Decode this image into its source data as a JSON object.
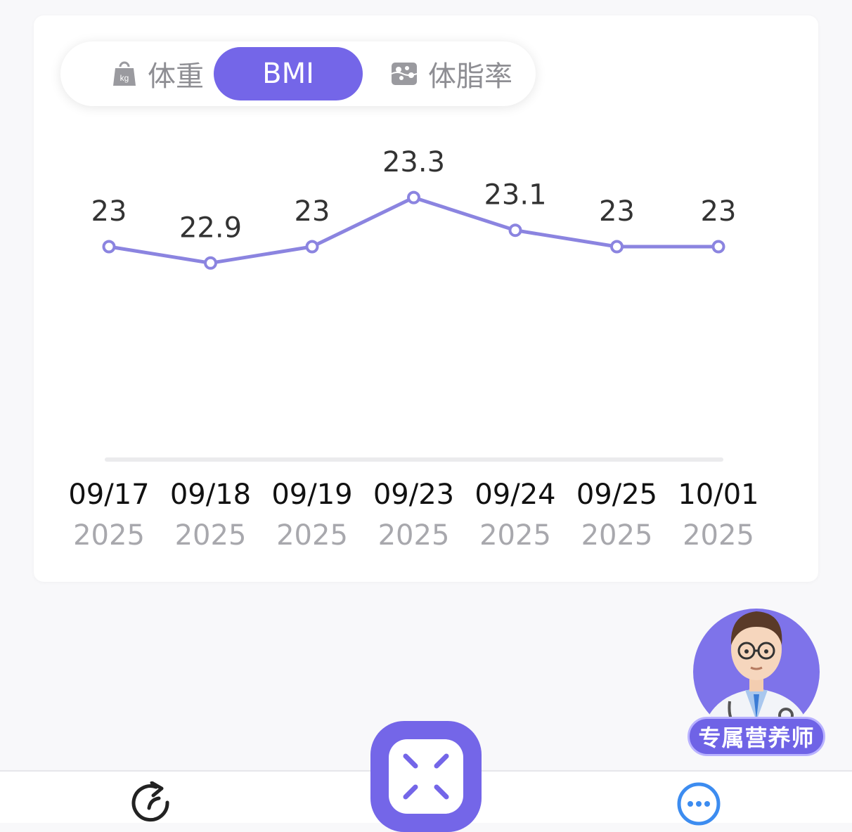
{
  "tabs": [
    {
      "label": "体重",
      "icon": "weight-bag-icon",
      "active": false
    },
    {
      "label": "BMI",
      "icon": "",
      "active": true
    },
    {
      "label": "体脂率",
      "icon": "body-fat-icon",
      "active": false
    }
  ],
  "colors": {
    "accent": "#7466e8",
    "line": "#8b84e0",
    "date_text": "#111111",
    "year_text": "#a8a8ad",
    "label_text": "#333333"
  },
  "chart_data": {
    "type": "line",
    "x": [
      "09/17",
      "09/18",
      "09/19",
      "09/23",
      "09/24",
      "09/25",
      "10/01"
    ],
    "x_sublabels": [
      "2025",
      "2025",
      "2025",
      "2025",
      "2025",
      "2025",
      "2025"
    ],
    "series": [
      {
        "values": [
          23,
          22.9,
          23,
          23.3,
          23.1,
          23,
          23
        ]
      }
    ],
    "data_labels": [
      "23",
      "22.9",
      "23",
      "23.3",
      "23.1",
      "23",
      "23"
    ],
    "title": "",
    "xlabel": "",
    "ylabel": "",
    "grid": false,
    "legend": "none"
  },
  "doctor": {
    "badge_label": "专属营养师",
    "avatar_icon": "doctor-avatar-icon"
  },
  "nav": {
    "left_icon": "refresh-icon",
    "center_icon": "scan-icon",
    "right_icon": "chat-icon"
  }
}
